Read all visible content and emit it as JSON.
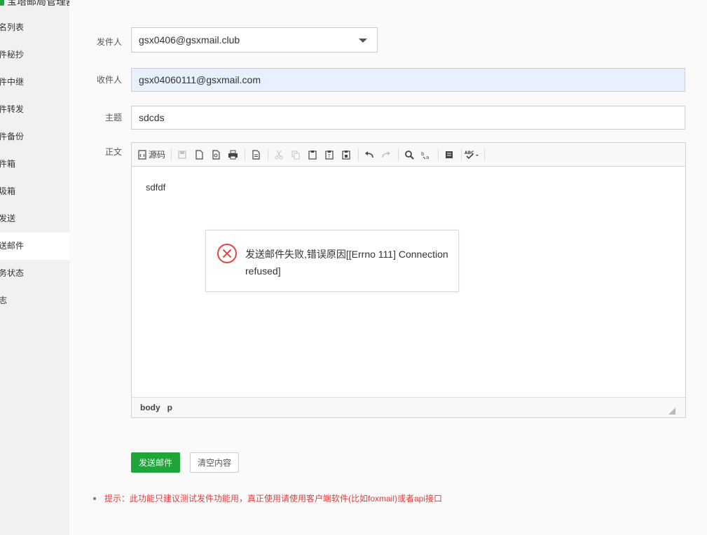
{
  "sidebar": {
    "title": "宝塔邮局管理器",
    "items": [
      {
        "label": "域名列表"
      },
      {
        "label": "邮件秘抄"
      },
      {
        "label": "邮件中继"
      },
      {
        "label": "邮件转发"
      },
      {
        "label": "邮件备份"
      },
      {
        "label": "收件箱"
      },
      {
        "label": "垃圾箱"
      },
      {
        "label": "已发送"
      },
      {
        "label": "发送邮件",
        "active": true
      },
      {
        "label": "服务状态"
      },
      {
        "label": "日志"
      }
    ]
  },
  "form": {
    "from_label": "发件人",
    "from_value": "gsx0406@gsxmail.club",
    "to_label": "收件人",
    "to_value": "gsx04060111@gsxmail.com",
    "subject_label": "主题",
    "subject_value": "sdcds",
    "body_label": "正文"
  },
  "editor": {
    "source_label": "源码",
    "body_text": "sdfdf",
    "status_path": [
      "body",
      "p"
    ]
  },
  "error_popup": {
    "message": "发送邮件失败,错误原因[[Errno 111] Connection refused]",
    "icon_color": "#e64340"
  },
  "buttons": {
    "send_label": "发送邮件",
    "clear_label": "清空内容"
  },
  "tip": "提示：此功能只建议测试发件功能用，真正使用请使用客户端软件(比如foxmail)或者api接口",
  "colors": {
    "accent": "#20a53a",
    "tip": "#e13e3e",
    "autofill": "#e8f0fe"
  }
}
